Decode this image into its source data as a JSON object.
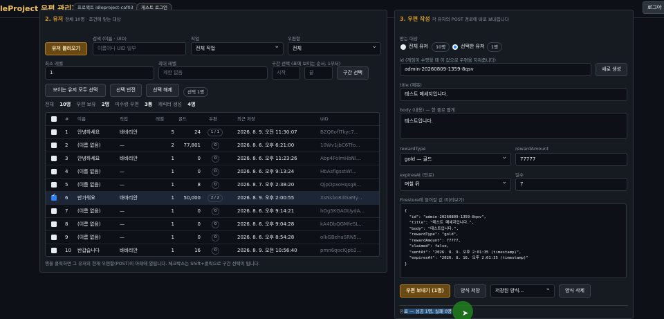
{
  "header": {
    "app_title": "IdleProject 우편 관리자",
    "project_badge": "프로젝트 idleproject-caf03",
    "guest_badge": "게스트 로그인",
    "login_button": "로그아"
  },
  "left_panel": {
    "title": "2. 유저",
    "subtitle": "전체 10명 · 조건에 맞는 대상",
    "load_button": "유저 불러오기",
    "search_label": "검색 (이름 · UID)",
    "search_placeholder": "이름이나 UID 일부",
    "job_label": "직업",
    "job_value": "전체 직업",
    "mail_label": "우편함",
    "mail_value": "전체",
    "min_level_label": "최소 레벨",
    "min_level_value": "1",
    "max_level_label": "최대 레벨",
    "max_level_placeholder": "제한 없음",
    "range_label": "구간 선택 (표에 보이는 순서, 1부터)",
    "range_start_placeholder": "시작",
    "range_end_placeholder": "끝",
    "range_button": "구간 선택",
    "select_all_button": "보이는 유저 모두 선택",
    "invert_button": "선택 반전",
    "clear_button": "선택 해제",
    "selected_count": "선택 1명",
    "stats": {
      "total_label": "전체",
      "total_value": "10명",
      "has_mail_label": "우편 보유",
      "has_mail_value": "2명",
      "unclaimed_label": "미수령 우편",
      "unclaimed_value": "3통",
      "chars_label": "캐릭터 생성",
      "chars_value": "4명"
    },
    "table": {
      "columns": [
        "#",
        "이름",
        "직업",
        "레벨",
        "골드",
        "우편",
        "최근 저장",
        "UID"
      ],
      "rows": [
        {
          "checked": false,
          "num": "1",
          "name": "안녕하세요",
          "job": "바바리안",
          "level": "5",
          "gold": "24",
          "mail": "1 / 1",
          "saved": "2026. 8. 9. 오전 11:30:07",
          "uid": "BZQ6oflTkyc7..."
        },
        {
          "checked": false,
          "num": "2",
          "name": "(이름 없음)",
          "job": "—",
          "level": "2",
          "gold": "77,801",
          "mail": "0",
          "saved": "2026. 8. 6. 오후 6:21:00",
          "uid": "10Wv1jbC6Tfo..."
        },
        {
          "checked": false,
          "num": "3",
          "name": "안녕하세요",
          "job": "바바리안",
          "level": "1",
          "gold": "0",
          "mail": "0",
          "saved": "2026. 8. 6. 오후 11:23:26",
          "uid": "Abp4FolmHbNl..."
        },
        {
          "checked": false,
          "num": "4",
          "name": "(이름 없음)",
          "job": "—",
          "level": "1",
          "gold": "0",
          "mail": "0",
          "saved": "2026. 8. 6. 오후 9:13:24",
          "uid": "HbAsflgsstWl..."
        },
        {
          "checked": false,
          "num": "5",
          "name": "(이름 없음)",
          "job": "—",
          "level": "1",
          "gold": "8",
          "mail": "0",
          "saved": "2026. 8. 7. 오후 2:38:20",
          "uid": "QjpOpxoHqsg8..."
        },
        {
          "checked": true,
          "num": "6",
          "name": "반가워요",
          "job": "바바리안",
          "level": "1",
          "gold": "50,000",
          "mail": "2 / 2",
          "saved": "2026. 8. 9. 오후 2:00:55",
          "uid": "XsNsbo8dGaMy..."
        },
        {
          "checked": false,
          "num": "7",
          "name": "(이름 없음)",
          "job": "—",
          "level": "1",
          "gold": "0",
          "mail": "0",
          "saved": "2026. 8. 6. 오후 9:14:21",
          "uid": "hOg5KGAOUydA..."
        },
        {
          "checked": false,
          "num": "8",
          "name": "(이름 없음)",
          "job": "—",
          "level": "1",
          "gold": "0",
          "mail": "0",
          "saved": "2026. 8. 6. 오후 9:04:28",
          "uid": "kA4DbQGMfeSL..."
        },
        {
          "checked": false,
          "num": "9",
          "name": "(이름 없음)",
          "job": "—",
          "level": "1",
          "gold": "0",
          "mail": "0",
          "saved": "2026. 8. 6. 오후 8:54:28",
          "uid": "oIkGBehaSRN5..."
        },
        {
          "checked": false,
          "num": "10",
          "name": "반갑습니다",
          "job": "바바리안",
          "level": "1",
          "gold": "16",
          "mail": "0",
          "saved": "2026. 8. 9. 오전 10:56:40",
          "uid": "pmn6qocKJpb2..."
        }
      ]
    },
    "footnote": "행을 클릭하면 그 유저의 현재 우편함(POST)이 아래에 열립니다. 체크박스는 Shift+클릭으로 구간 선택이 됩니다."
  },
  "right_panel": {
    "title": "3. 우편 작성",
    "subtitle": "각 유저의 POST 경로에 바로 보내집니다",
    "target_label": "받는 대상",
    "radio_all": "전체 유저",
    "radio_all_count": "10명",
    "radio_selected": "선택한 유저",
    "radio_selected_count": "1명",
    "id_label": "id (게임이 수령할 때 이 값으로 우편을 지워줍니다)",
    "id_value": "admin-20260809-1359-8qsv",
    "new_id_button": "새로 생성",
    "title_label": "title (제목)",
    "title_value": "테스트 메세지입니다.",
    "body_label": "body (내용) — 한 줄로 짧게",
    "body_value": "테스트입니다.",
    "reward_type_label": "rewardType",
    "reward_type_value": "gold — 골드",
    "reward_amount_label": "rewardAmount",
    "reward_amount_value": "77777",
    "expires_label": "expiresAt (만료)",
    "expires_value": "며칠 뒤",
    "days_label": "일수",
    "days_value": "7",
    "preview_label": "Firestore에 들어갈 값 (미리보기)",
    "preview_text": "{\n  \"id\": \"admin-20260809-1359-8qsv\",\n  \"title\": \"테스트 메세지입니다.\",\n  \"body\": \"테스트입니다.\",\n  \"rewardType\": \"gold\",\n  \"rewardAmount\": 77777,\n  \"claimed\": false,\n  \"sentAt\": \"2026. 8. 9. 오후 2:01:35 (timestamp)\",\n  \"expiresAt\": \"2026. 8. 16. 오후 2:01:35 (timestamp)\"\n}",
    "send_button": "우편 보내기 (1명)",
    "save_template_button": "양식 저장",
    "saved_templates_value": "저장된 양식...",
    "delete_template_button": "양식 삭제",
    "result_prefix": "완",
    "result_text": "료 — 성공 1명, 실패 0명"
  }
}
